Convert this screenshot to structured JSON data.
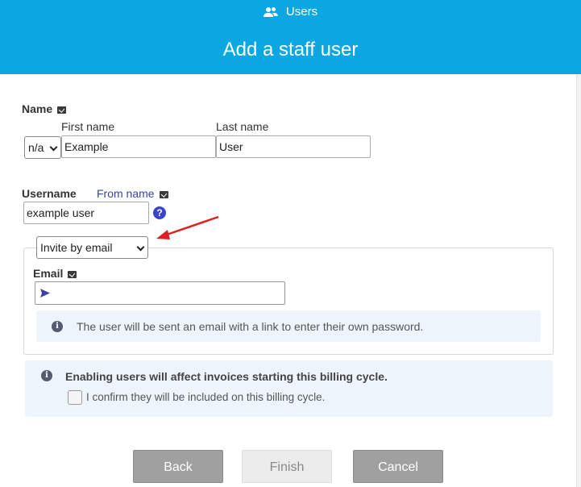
{
  "header": {
    "breadcrumb": "Users",
    "title": "Add a staff user"
  },
  "name_section": {
    "label": "Name",
    "title_select": "n/a",
    "first_name_label": "First name",
    "first_name_value": "Example",
    "last_name_label": "Last name",
    "last_name_value": "User"
  },
  "username_section": {
    "label": "Username",
    "from_name_label": "From name",
    "value": "example user",
    "help_glyph": "?"
  },
  "invite": {
    "method_select": "Invite by email",
    "email_label": "Email",
    "email_value": "",
    "info_text": "The user will be sent an email with a link to enter their own password."
  },
  "billing": {
    "notice": "Enabling users will affect invoices starting this billing cycle.",
    "confirm_label": "I confirm they will be included on this billing cycle.",
    "confirmed": false
  },
  "buttons": {
    "back": "Back",
    "finish": "Finish",
    "cancel": "Cancel"
  },
  "colors": {
    "header_bg": "#0aa7e2",
    "info_bg": "#eef4fc",
    "link_blue": "#3b45c9",
    "arrow_red": "#e02020"
  }
}
